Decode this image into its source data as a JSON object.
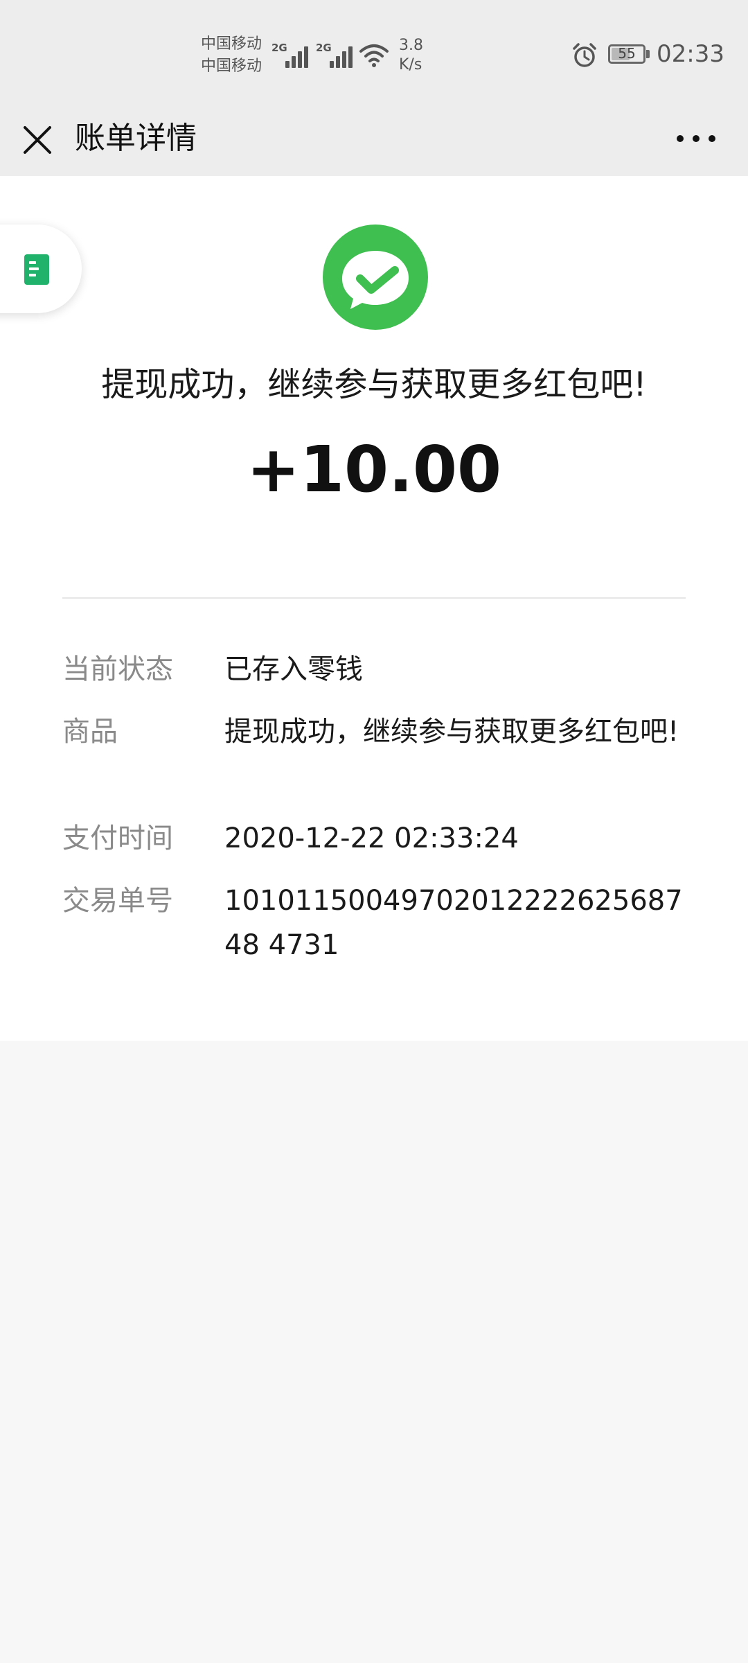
{
  "status_bar": {
    "carrier_1": "中国移动",
    "carrier_2": "中国移动",
    "sim1_network": "2G",
    "sim2_network": "2G",
    "speed_value": "3.8",
    "speed_unit": "K/s",
    "battery": "55",
    "time": "02:33"
  },
  "nav": {
    "title": "账单详情"
  },
  "header": {
    "headline": "提现成功，继续参与获取更多红包吧!",
    "amount": "+10.00"
  },
  "details": [
    {
      "label": "当前状态",
      "value": "已存入零钱"
    },
    {
      "label": "商品",
      "value": "提现成功，继续参与获取更多红包吧!"
    },
    {
      "label": "支付时间",
      "value": "2020-12-22 02:33:24"
    },
    {
      "label": "交易单号",
      "value": "1010115004970201222262568748 4731"
    }
  ],
  "colors": {
    "brand_green": "#3fbf4f",
    "nav_background": "#ededed",
    "page_background": "#f7f7f7"
  },
  "icons": {
    "close": "close-icon",
    "more": "more-icon",
    "logo": "wechat-pay-logo-icon",
    "float_tab": "bill-document-icon"
  }
}
